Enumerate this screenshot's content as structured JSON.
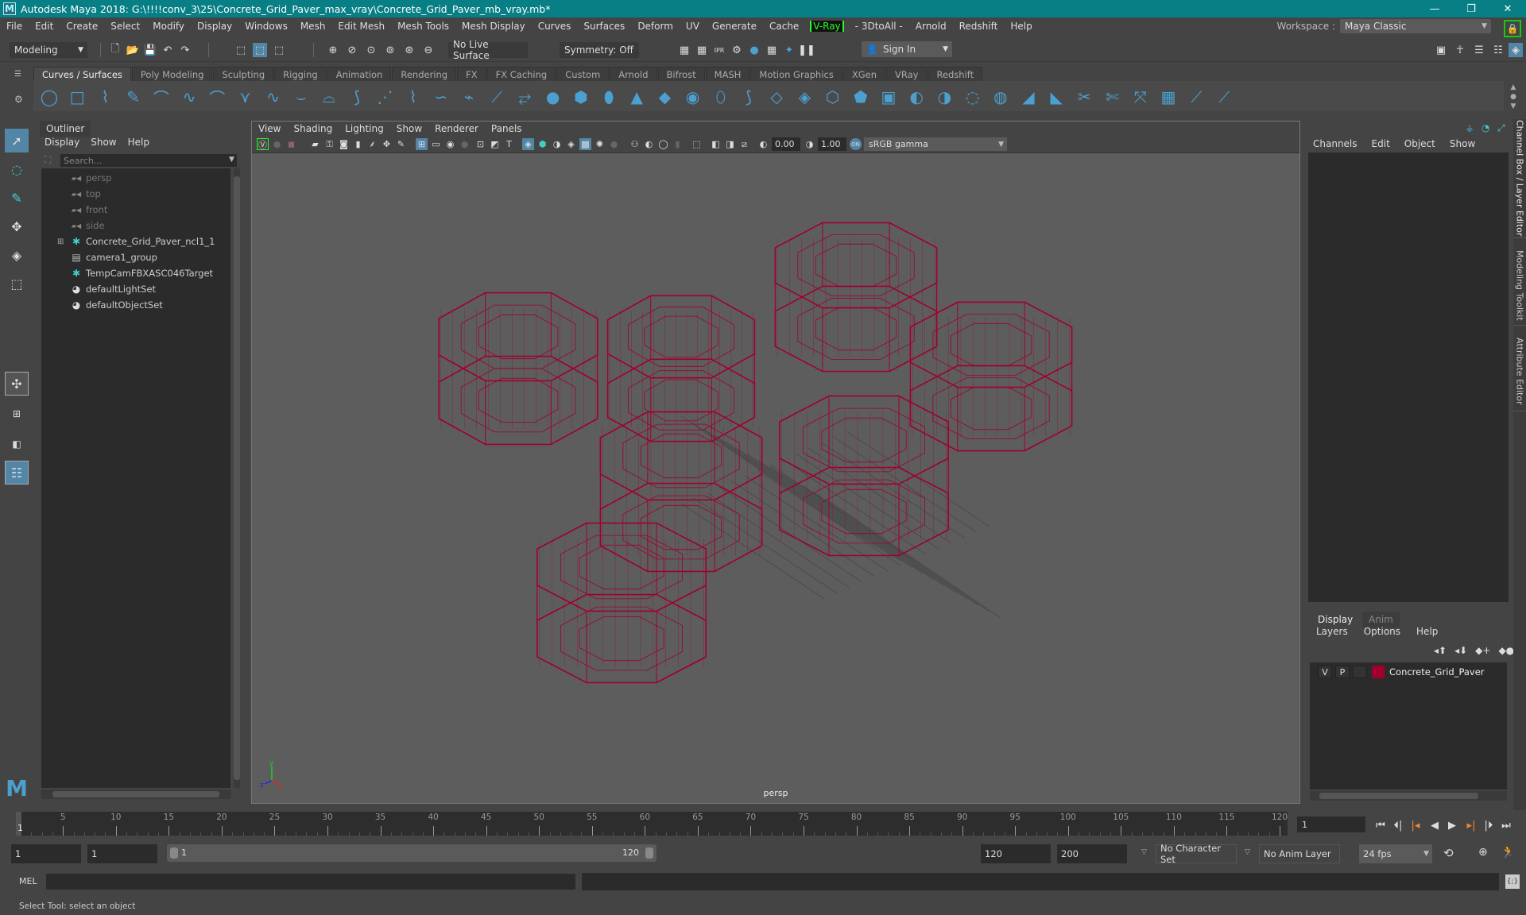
{
  "window": {
    "title": "Autodesk Maya 2018: G:\\!!!!conv_3\\25\\Concrete_Grid_Paver_max_vray\\Concrete_Grid_Paver_mb_vray.mb*",
    "logo": "M",
    "controls": {
      "minimize": "—",
      "restore": "❐",
      "close": "✕"
    }
  },
  "menubar": {
    "items": [
      "File",
      "Edit",
      "Create",
      "Select",
      "Modify",
      "Display",
      "Windows",
      "Mesh",
      "Edit Mesh",
      "Mesh Tools",
      "Mesh Display",
      "Curves",
      "Surfaces",
      "Deform",
      "UV",
      "Generate",
      "Cache",
      "V-Ray",
      "- 3DtoAll -",
      "Arnold",
      "Redshift",
      "Help"
    ]
  },
  "workspace": {
    "label": "Workspace :",
    "value": "Maya Classic"
  },
  "statusline": {
    "menuset": "Modeling",
    "live_surface": "No Live Surface",
    "symmetry": "Symmetry: Off",
    "sign_in": "Sign In"
  },
  "shelf": {
    "tabs": [
      "Curves / Surfaces",
      "Poly Modeling",
      "Sculpting",
      "Rigging",
      "Animation",
      "Rendering",
      "FX",
      "FX Caching",
      "Custom",
      "Arnold",
      "Bifrost",
      "MASH",
      "Motion Graphics",
      "XGen",
      "VRay",
      "Redshift"
    ],
    "active_tab": "Curves / Surfaces"
  },
  "outliner": {
    "tab": "Outliner",
    "menu": [
      "Display",
      "Show",
      "Help"
    ],
    "search_placeholder": "Search...",
    "items": [
      {
        "label": "persp",
        "icon": "camera-icon",
        "dim": true,
        "expandable": false
      },
      {
        "label": "top",
        "icon": "camera-icon",
        "dim": true,
        "expandable": false
      },
      {
        "label": "front",
        "icon": "camera-icon",
        "dim": true,
        "expandable": false
      },
      {
        "label": "side",
        "icon": "camera-icon",
        "dim": true,
        "expandable": false
      },
      {
        "label": "Concrete_Grid_Paver_ncl1_1",
        "icon": "locator-icon",
        "dim": false,
        "expandable": true
      },
      {
        "label": "camera1_group",
        "icon": "group-icon",
        "dim": false,
        "expandable": false
      },
      {
        "label": "TempCamFBXASC046Target",
        "icon": "locator-icon",
        "dim": false,
        "expandable": false
      },
      {
        "label": "defaultLightSet",
        "icon": "set-icon",
        "dim": false,
        "expandable": false
      },
      {
        "label": "defaultObjectSet",
        "icon": "set-icon",
        "dim": false,
        "expandable": false
      }
    ]
  },
  "viewport": {
    "menu": [
      "View",
      "Shading",
      "Lighting",
      "Show",
      "Renderer",
      "Panels"
    ],
    "exposure": "0.00",
    "gamma": "1.00",
    "color_space": "sRGB gamma",
    "camera_label": "persp",
    "wire_color": "#a0002e",
    "axis": {
      "x": "x",
      "y": "y",
      "z": "z"
    }
  },
  "channelbox": {
    "menu": [
      "Channels",
      "Edit",
      "Object",
      "Show"
    ]
  },
  "layers": {
    "tabs": [
      "Display",
      "Anim"
    ],
    "active_tab": "Display",
    "menu": [
      "Layers",
      "Options",
      "Help"
    ],
    "rows": [
      {
        "visible": "V",
        "playback": "P",
        "name": "Concrete_Grid_Paver",
        "color": "#a0002e"
      }
    ]
  },
  "right_tabs": [
    "Channel Box / Layer Editor",
    "Modeling Toolkit",
    "Attribute Editor"
  ],
  "timeline": {
    "start": 1,
    "end": 120,
    "current_frame": "1",
    "tick_labels": [
      "5",
      "10",
      "15",
      "20",
      "25",
      "30",
      "35",
      "40",
      "45",
      "50",
      "55",
      "60",
      "65",
      "70",
      "75",
      "80",
      "85",
      "90",
      "95",
      "100",
      "105",
      "110",
      "115",
      "120"
    ],
    "current_label": "1"
  },
  "range": {
    "start_time": "1",
    "playback_start": "1",
    "slider_start": "1",
    "slider_end": "120",
    "playback_end": "120",
    "end_time": "200",
    "character_set": "No Character Set",
    "anim_layer": "No Anim Layer",
    "fps": "24 fps"
  },
  "commandline": {
    "language": "MEL"
  },
  "status": {
    "help_text": "Select Tool: select an object"
  }
}
